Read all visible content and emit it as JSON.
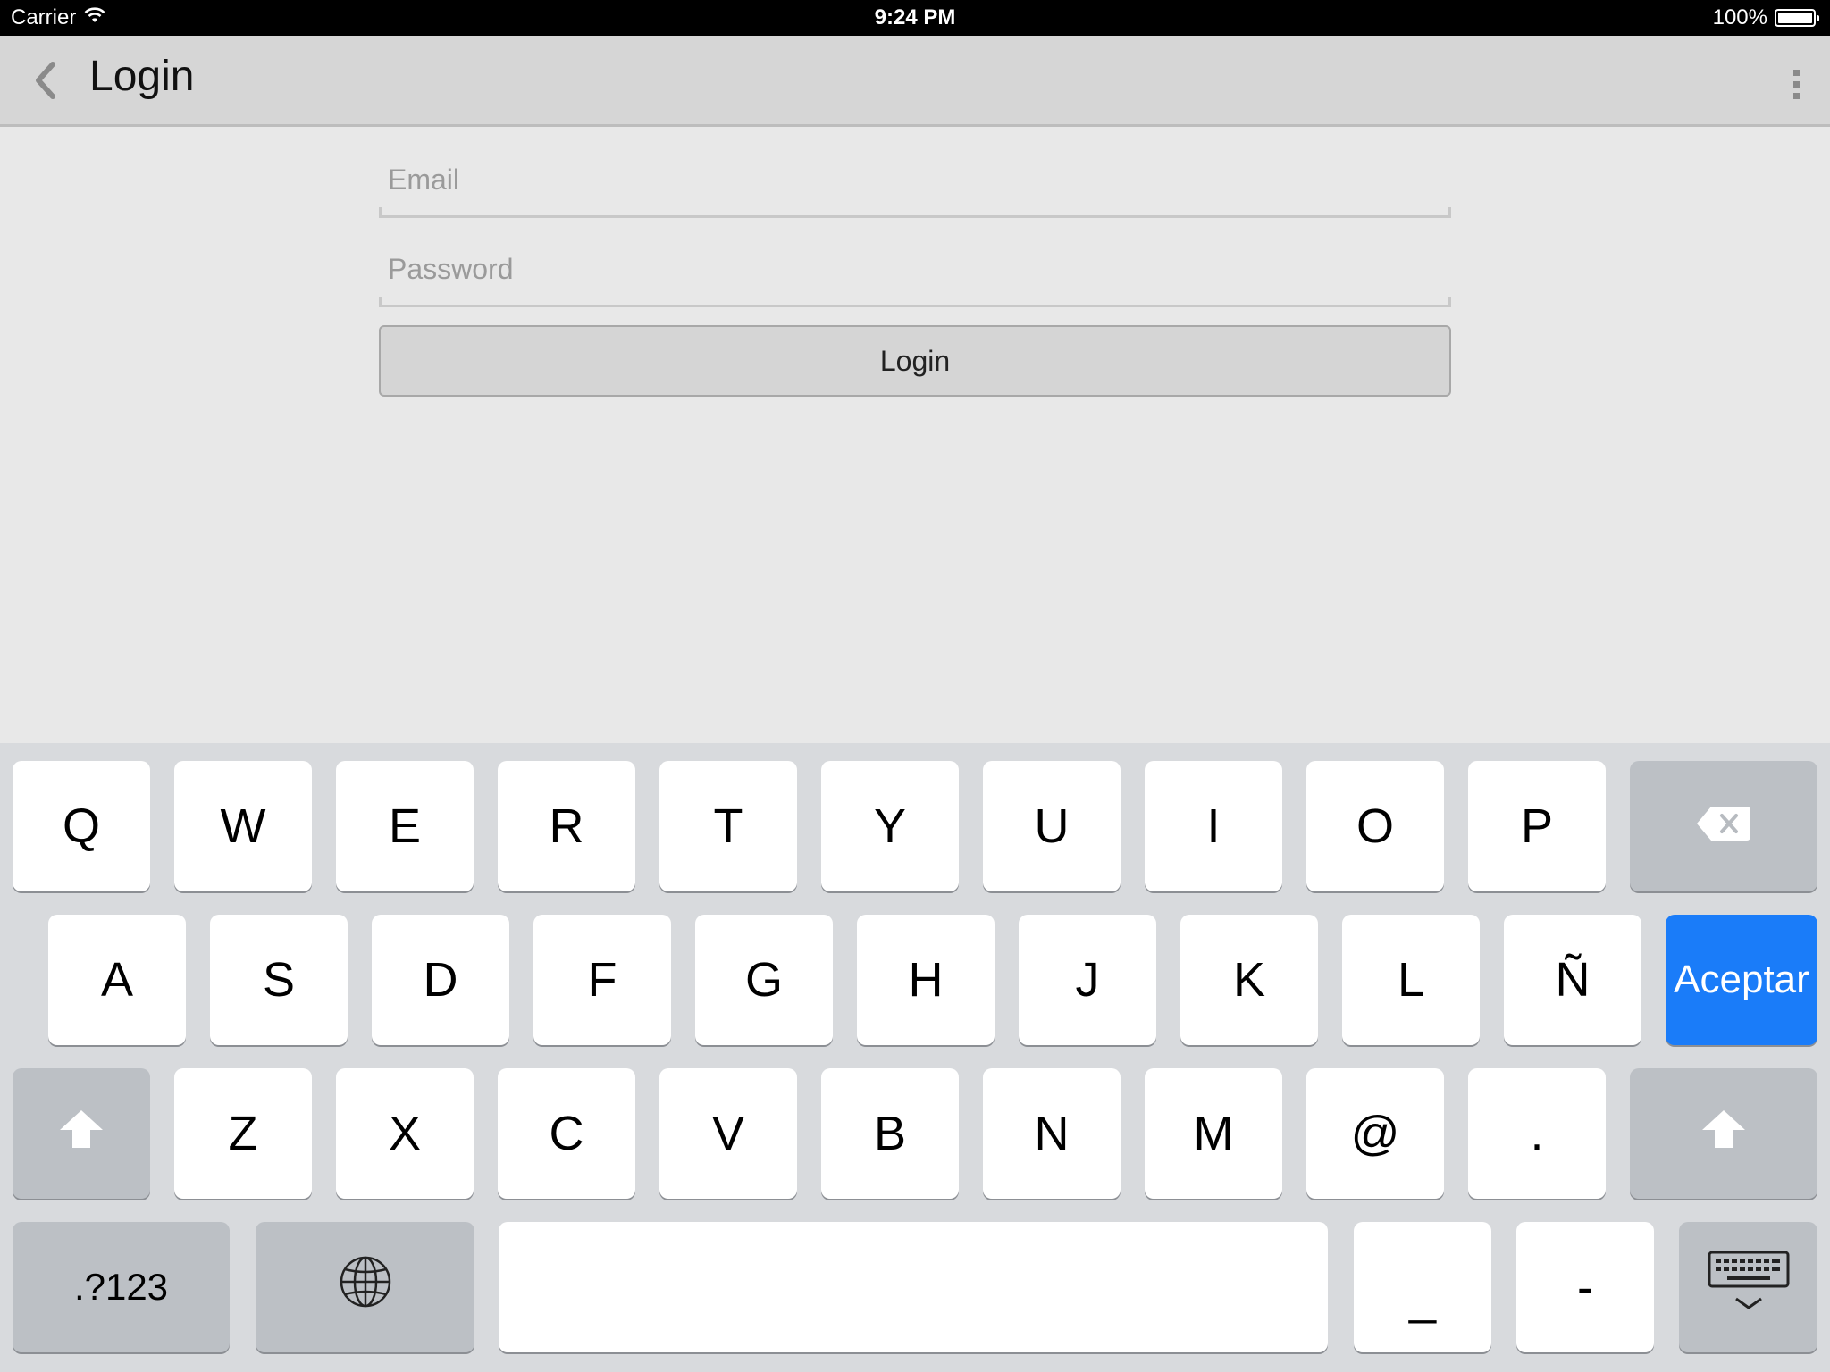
{
  "status_bar": {
    "carrier": "Carrier",
    "time": "9:24 PM",
    "battery": "100%"
  },
  "nav": {
    "title": "Login"
  },
  "form": {
    "email_placeholder": "Email",
    "password_placeholder": "Password",
    "login_label": "Login"
  },
  "keyboard": {
    "row1": [
      "Q",
      "W",
      "E",
      "R",
      "T",
      "Y",
      "U",
      "I",
      "O",
      "P"
    ],
    "row2": [
      "A",
      "S",
      "D",
      "F",
      "G",
      "H",
      "J",
      "K",
      "L",
      "Ñ"
    ],
    "row3": [
      "Z",
      "X",
      "C",
      "V",
      "B",
      "N",
      "M",
      "@",
      "."
    ],
    "return_label": "Aceptar",
    "numbers_label": ".?123",
    "underscore_label": "_",
    "hyphen_label": "-"
  },
  "colors": {
    "accent": "#1a7cf9",
    "navbar": "#d6d6d6",
    "background": "#e8e8e8",
    "keyboard": "#d8dadd"
  },
  "icons": {
    "back": "chevron-left-icon",
    "overflow": "more-vertical-icon",
    "wifi": "wifi-icon",
    "battery": "battery-icon",
    "backspace": "backspace-icon",
    "shift": "shift-icon",
    "globe": "globe-icon",
    "dismiss": "keyboard-dismiss-icon"
  }
}
